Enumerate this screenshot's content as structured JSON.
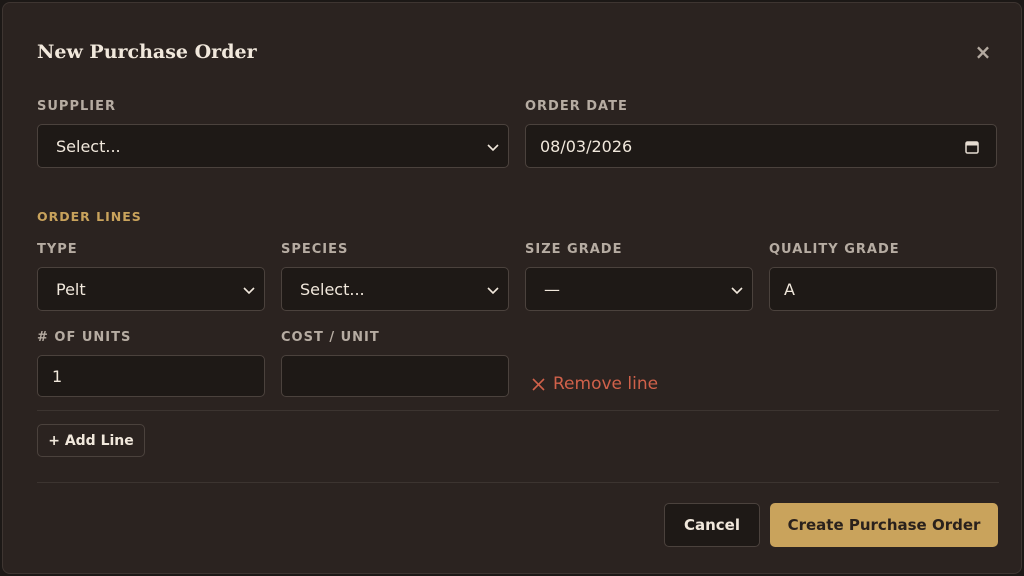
{
  "dialog": {
    "title": "New Purchase Order",
    "close_glyph": "×"
  },
  "supplier": {
    "label": "SUPPLIER",
    "value": "Select..."
  },
  "order_date": {
    "label": "ORDER DATE",
    "value": "08/03/2026"
  },
  "order_lines": {
    "section_label": "ORDER LINES",
    "type": {
      "label": "TYPE",
      "value": "Pelt"
    },
    "species": {
      "label": "SPECIES",
      "value": "Select..."
    },
    "size_grade": {
      "label": "SIZE GRADE",
      "value": "—"
    },
    "quality_grade": {
      "label": "QUALITY GRADE",
      "value": "A"
    },
    "units": {
      "label": "# OF UNITS",
      "value": "1"
    },
    "cost": {
      "label": "COST / UNIT",
      "value": ""
    },
    "remove_label": "Remove line",
    "add_label": "+ Add Line"
  },
  "footer": {
    "cancel_label": "Cancel",
    "create_label": "Create Purchase Order"
  },
  "icons": {
    "close": "close-icon",
    "chevron": "chevron-down-icon",
    "calendar": "calendar-icon",
    "remove": "x-icon"
  },
  "colors": {
    "background": "#2b2320",
    "field": "#1e1916",
    "accent": "#c9a35c",
    "danger": "#d0614a",
    "text": "#f1e8dc",
    "muted": "#b6aca2"
  }
}
